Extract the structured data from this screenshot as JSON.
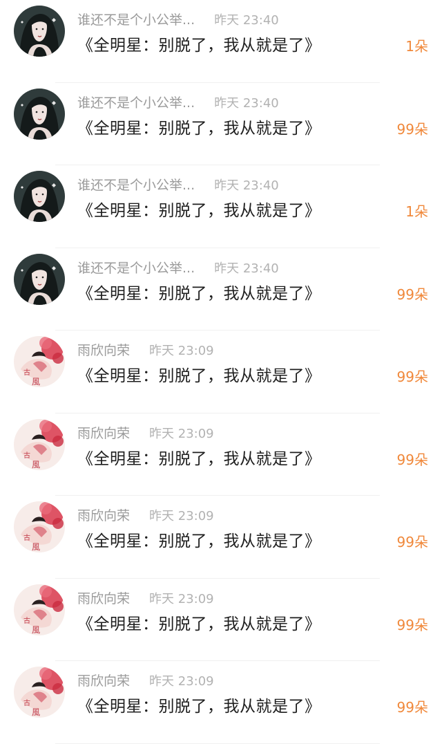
{
  "rows": [
    {
      "user": "谁还不是个小公举...",
      "time": "昨天 23:40",
      "message": "《全明星：别脱了，我从就是了》",
      "count": "1朵",
      "avatar": "dark-haired-girl-avatar"
    },
    {
      "user": "谁还不是个小公举...",
      "time": "昨天 23:40",
      "message": "《全明星：别脱了，我从就是了》",
      "count": "99朵",
      "avatar": "dark-haired-girl-avatar"
    },
    {
      "user": "谁还不是个小公举...",
      "time": "昨天 23:40",
      "message": "《全明星：别脱了，我从就是了》",
      "count": "1朵",
      "avatar": "dark-haired-girl-avatar"
    },
    {
      "user": "谁还不是个小公举...",
      "time": "昨天 23:40",
      "message": "《全明星：别脱了，我从就是了》",
      "count": "99朵",
      "avatar": "dark-haired-girl-avatar"
    },
    {
      "user": "雨欣向荣",
      "time": "昨天 23:09",
      "message": "《全明星：别脱了，我从就是了》",
      "count": "99朵",
      "avatar": "guofeng-painting-avatar"
    },
    {
      "user": "雨欣向荣",
      "time": "昨天 23:09",
      "message": "《全明星：别脱了，我从就是了》",
      "count": "99朵",
      "avatar": "guofeng-painting-avatar"
    },
    {
      "user": "雨欣向荣",
      "time": "昨天 23:09",
      "message": "《全明星：别脱了，我从就是了》",
      "count": "99朵",
      "avatar": "guofeng-painting-avatar"
    },
    {
      "user": "雨欣向荣",
      "time": "昨天 23:09",
      "message": "《全明星：别脱了，我从就是了》",
      "count": "99朵",
      "avatar": "guofeng-painting-avatar"
    },
    {
      "user": "雨欣向荣",
      "time": "昨天 23:09",
      "message": "《全明星：别脱了，我从就是了》",
      "count": "99朵",
      "avatar": "guofeng-painting-avatar"
    }
  ],
  "colors": {
    "username": "#9a9a9a",
    "time": "#b2b2b2",
    "message": "#1e1e1e",
    "count": "#f0883a",
    "divider": "#f0f0f0"
  }
}
